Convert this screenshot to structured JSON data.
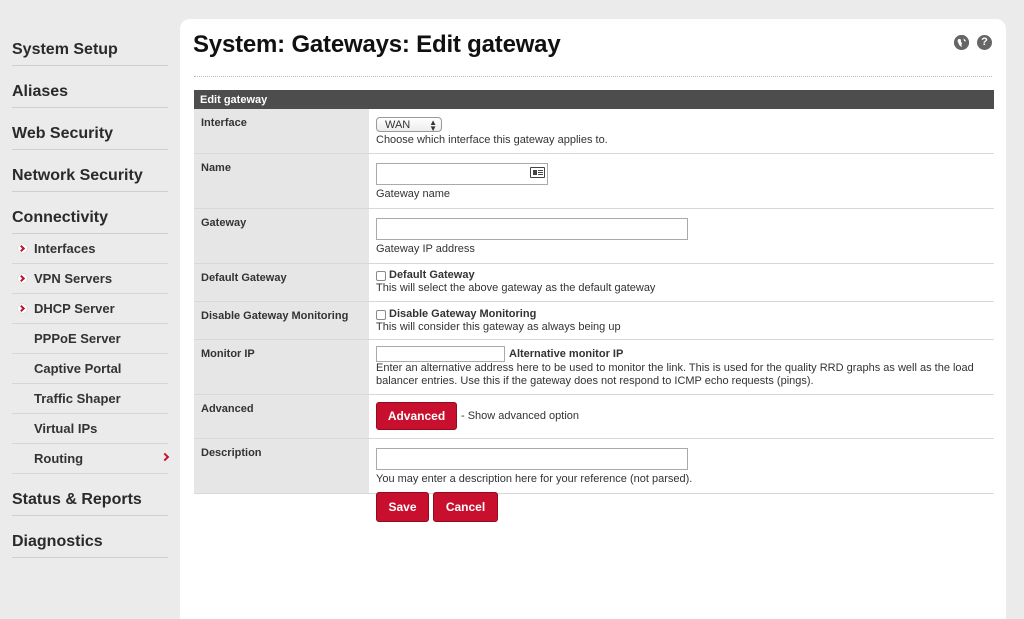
{
  "sidebar": {
    "sections_top": [
      "System Setup",
      "Aliases",
      "Web Security",
      "Network Security",
      "Connectivity"
    ],
    "connectivity_items": [
      {
        "label": "Interfaces",
        "marked": true
      },
      {
        "label": "VPN Servers",
        "marked": true
      },
      {
        "label": "DHCP Server",
        "marked": true
      },
      {
        "label": "PPPoE Server",
        "marked": false
      },
      {
        "label": "Captive Portal",
        "marked": false
      },
      {
        "label": "Traffic Shaper",
        "marked": false
      },
      {
        "label": "Virtual IPs",
        "marked": false
      },
      {
        "label": "Routing",
        "marked": false,
        "active": true
      }
    ],
    "sections_bottom": [
      "Status & Reports",
      "Diagnostics"
    ]
  },
  "header": {
    "title": "System: Gateways: Edit gateway",
    "icons": [
      "globe-icon",
      "help-icon"
    ]
  },
  "form": {
    "heading": "Edit gateway",
    "interface": {
      "label": "Interface",
      "selected": "WAN",
      "help": "Choose which interface this gateway applies to."
    },
    "name": {
      "label": "Name",
      "value": "",
      "help": "Gateway name"
    },
    "gateway": {
      "label": "Gateway",
      "value": "",
      "help": "Gateway IP address"
    },
    "default_gateway": {
      "label": "Default Gateway",
      "checkbox_label": "Default Gateway",
      "checked": false,
      "help": "This will select the above gateway as the default gateway"
    },
    "disable_monitoring": {
      "label": "Disable Gateway Monitoring",
      "checkbox_label": "Disable Gateway Monitoring",
      "checked": false,
      "help": "This will consider this gateway as always being up"
    },
    "monitor_ip": {
      "label": "Monitor IP",
      "value": "",
      "inline_label": "Alternative monitor IP",
      "help": "Enter an alternative address here to be used to monitor the link. This is used for the quality RRD graphs as well as the load balancer entries. Use this if the gateway does not respond to ICMP echo requests (pings)."
    },
    "advanced": {
      "label": "Advanced",
      "button": "Advanced",
      "help": "- Show advanced option"
    },
    "description": {
      "label": "Description",
      "value": "",
      "help": "You may enter a description here for your reference (not parsed)."
    }
  },
  "actions": {
    "save": "Save",
    "cancel": "Cancel"
  },
  "colors": {
    "accent": "#c8102e",
    "form_header": "#4d4d4d",
    "label_bg": "#e6e6e6"
  }
}
